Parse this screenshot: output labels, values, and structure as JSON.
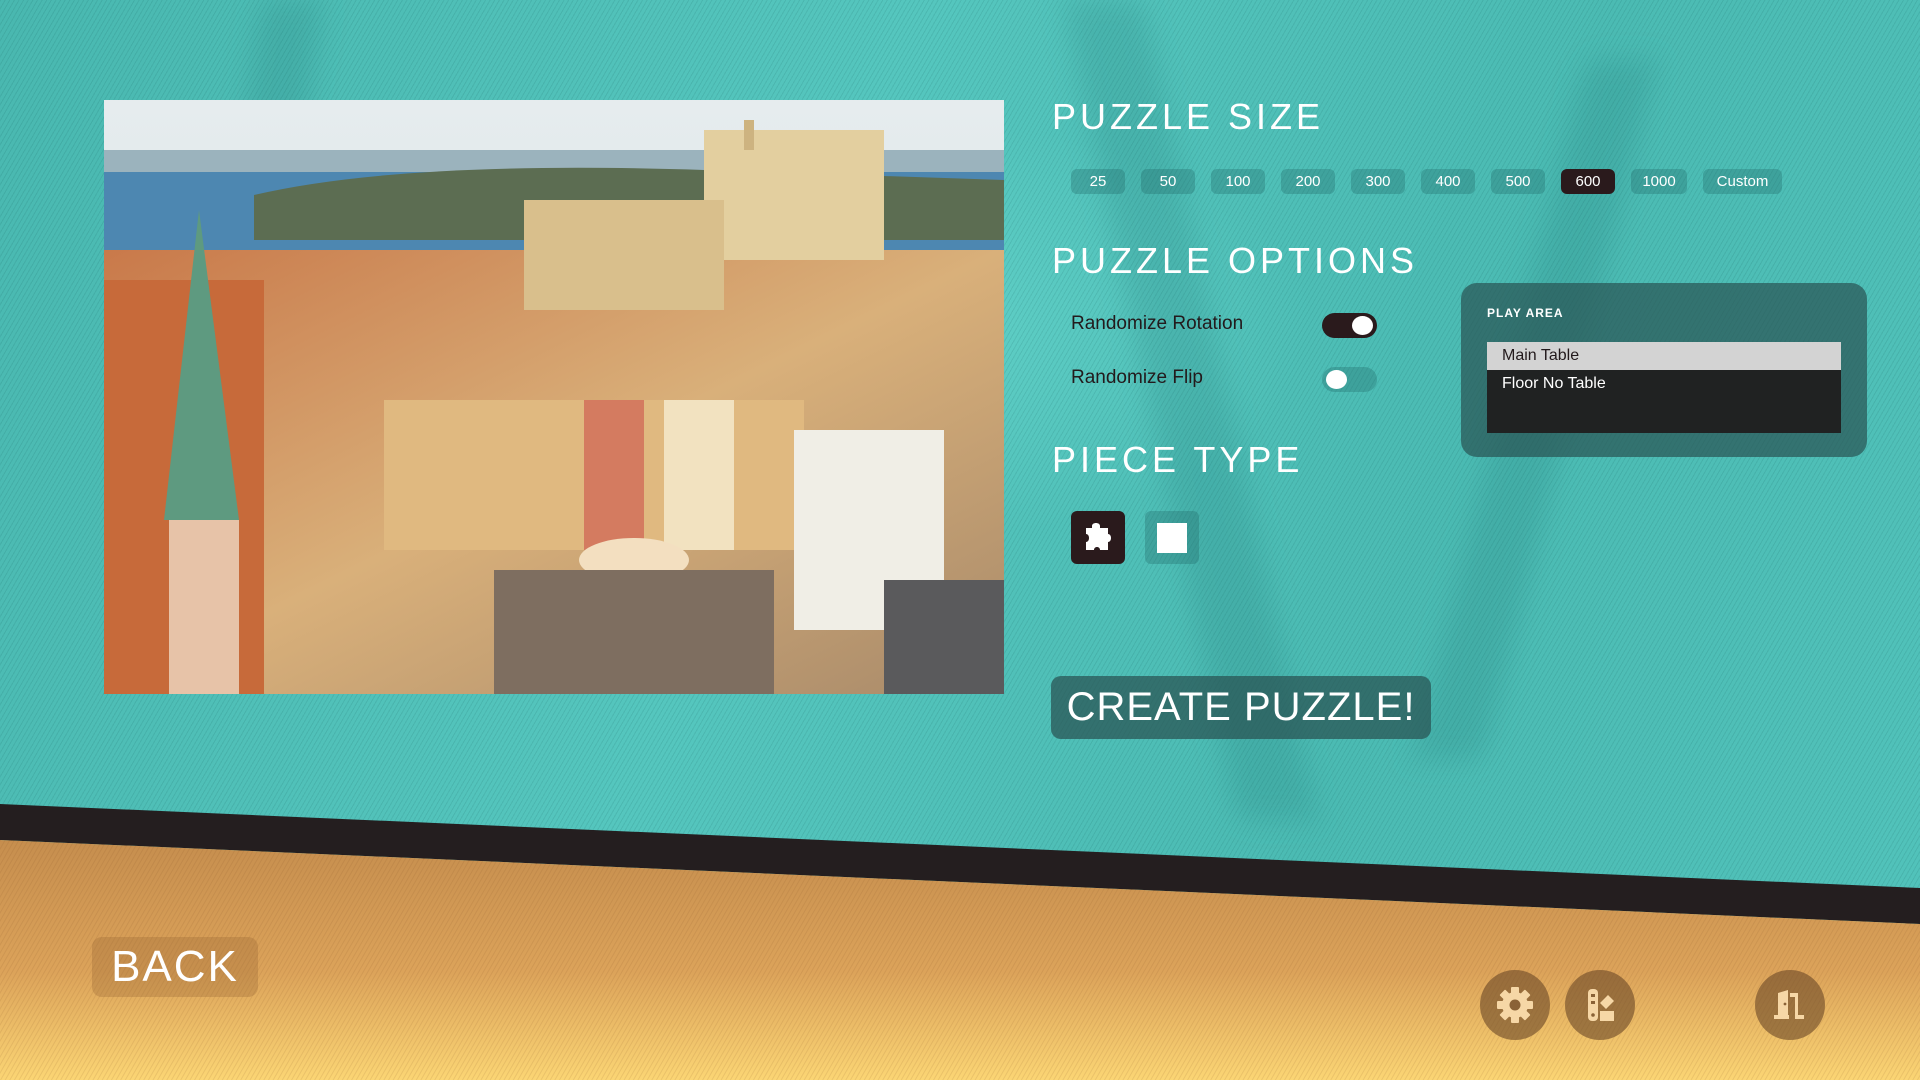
{
  "puzzle_size": {
    "title": "PUZZLE SIZE",
    "options": [
      "25",
      "50",
      "100",
      "200",
      "300",
      "400",
      "500",
      "600",
      "1000",
      "Custom"
    ],
    "selected": "600"
  },
  "puzzle_options": {
    "title": "PUZZLE OPTIONS",
    "randomize_rotation": {
      "label": "Randomize Rotation",
      "enabled": true
    },
    "randomize_flip": {
      "label": "Randomize Flip",
      "enabled": false
    }
  },
  "piece_type": {
    "title": "PIECE TYPE",
    "options": [
      {
        "name": "jigsaw",
        "icon": "puzzle-piece-icon",
        "selected": true
      },
      {
        "name": "square",
        "icon": "square-icon",
        "selected": false
      }
    ]
  },
  "play_area": {
    "title": "PLAY AREA",
    "items": [
      "Main Table",
      "Floor No Table"
    ],
    "selected": "Main Table"
  },
  "create_button": {
    "label": "CREATE PUZZLE!"
  },
  "back_button": {
    "label": "BACK"
  },
  "footer_icons": [
    "gear-icon",
    "palette-icon",
    "exit-door-icon"
  ],
  "preview_image": {
    "description": "Aerial view of old town with castle and lake"
  },
  "colors": {
    "teal_bg": "#4fc1b9",
    "dark": "#2a1a1c",
    "orange_top": "#c89050",
    "orange_bottom": "#f8d070"
  }
}
